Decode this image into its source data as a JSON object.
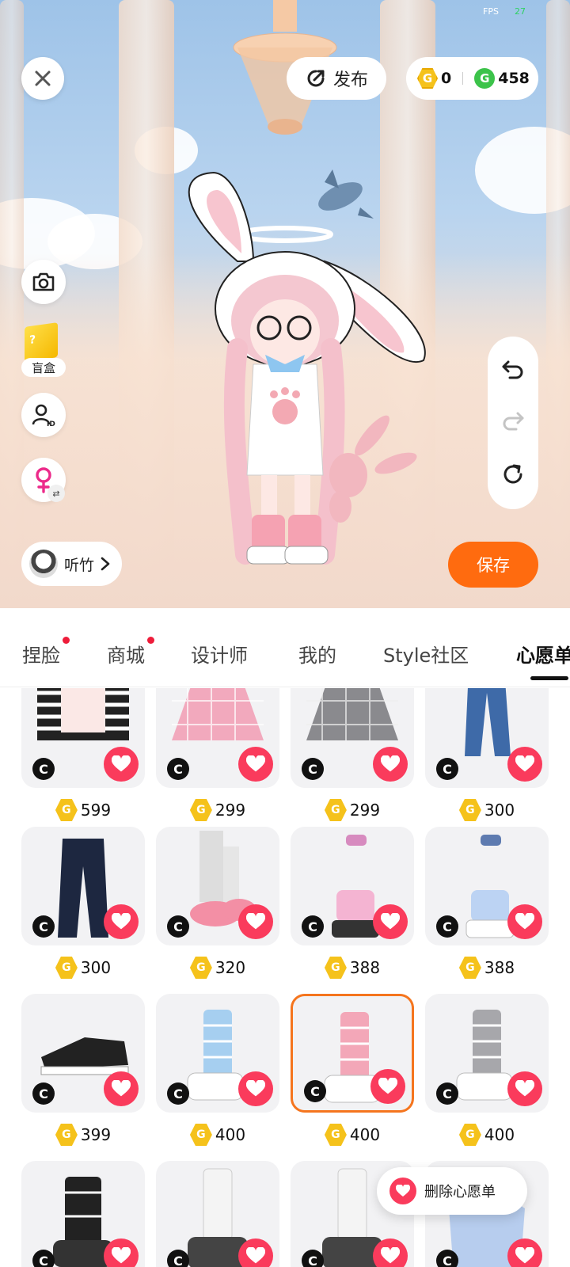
{
  "status": {
    "fps_label": "FPS",
    "fps_value": "27"
  },
  "top_bar": {
    "publish_label": "发布",
    "gold_balance": "0",
    "green_balance": "458"
  },
  "side": {
    "blind_box_label": "盲盒"
  },
  "user": {
    "name": "听竹"
  },
  "save_label": "保存",
  "tabs": [
    {
      "label": "捏脸",
      "dot": true
    },
    {
      "label": "商城",
      "dot": true
    },
    {
      "label": "设计师",
      "dot": false
    },
    {
      "label": "我的",
      "dot": false
    },
    {
      "label": "Style社区",
      "dot": false
    },
    {
      "label": "心愿单",
      "dot": false,
      "active": true
    }
  ],
  "items": [
    {
      "price": "599",
      "kind": "striped-top"
    },
    {
      "price": "299",
      "kind": "pink-skirt"
    },
    {
      "price": "299",
      "kind": "gray-skirt"
    },
    {
      "price": "300",
      "kind": "blue-jeans"
    },
    {
      "price": "300",
      "kind": "dark-jeans"
    },
    {
      "price": "320",
      "kind": "pink-slippers"
    },
    {
      "price": "388",
      "kind": "pink-boots"
    },
    {
      "price": "388",
      "kind": "blue-boots"
    },
    {
      "price": "399",
      "kind": "black-sneakers"
    },
    {
      "price": "400",
      "kind": "blue-leg-warmers"
    },
    {
      "price": "400",
      "kind": "pink-leg-warmers",
      "selected": true
    },
    {
      "price": "400",
      "kind": "gray-leg-warmers"
    },
    {
      "price": "",
      "kind": "black-leg-warmers"
    },
    {
      "price": "",
      "kind": "white-leg-warmers"
    },
    {
      "price": "",
      "kind": "white-leg-warmers-2"
    },
    {
      "price": "",
      "kind": "blue-top"
    }
  ],
  "remove_wishlist_label": "删除心愿单",
  "icons": {
    "close": "close-icon",
    "publish": "publish-icon",
    "camera": "camera-icon",
    "id": "id-icon",
    "gender": "female-icon",
    "undo": "undo-icon",
    "redo": "redo-icon",
    "reset": "reset-icon",
    "heart": "heart-icon"
  },
  "colors": {
    "accent": "#ff6b0f",
    "heart": "#fa3b5c",
    "selected_border": "#f5751e"
  }
}
